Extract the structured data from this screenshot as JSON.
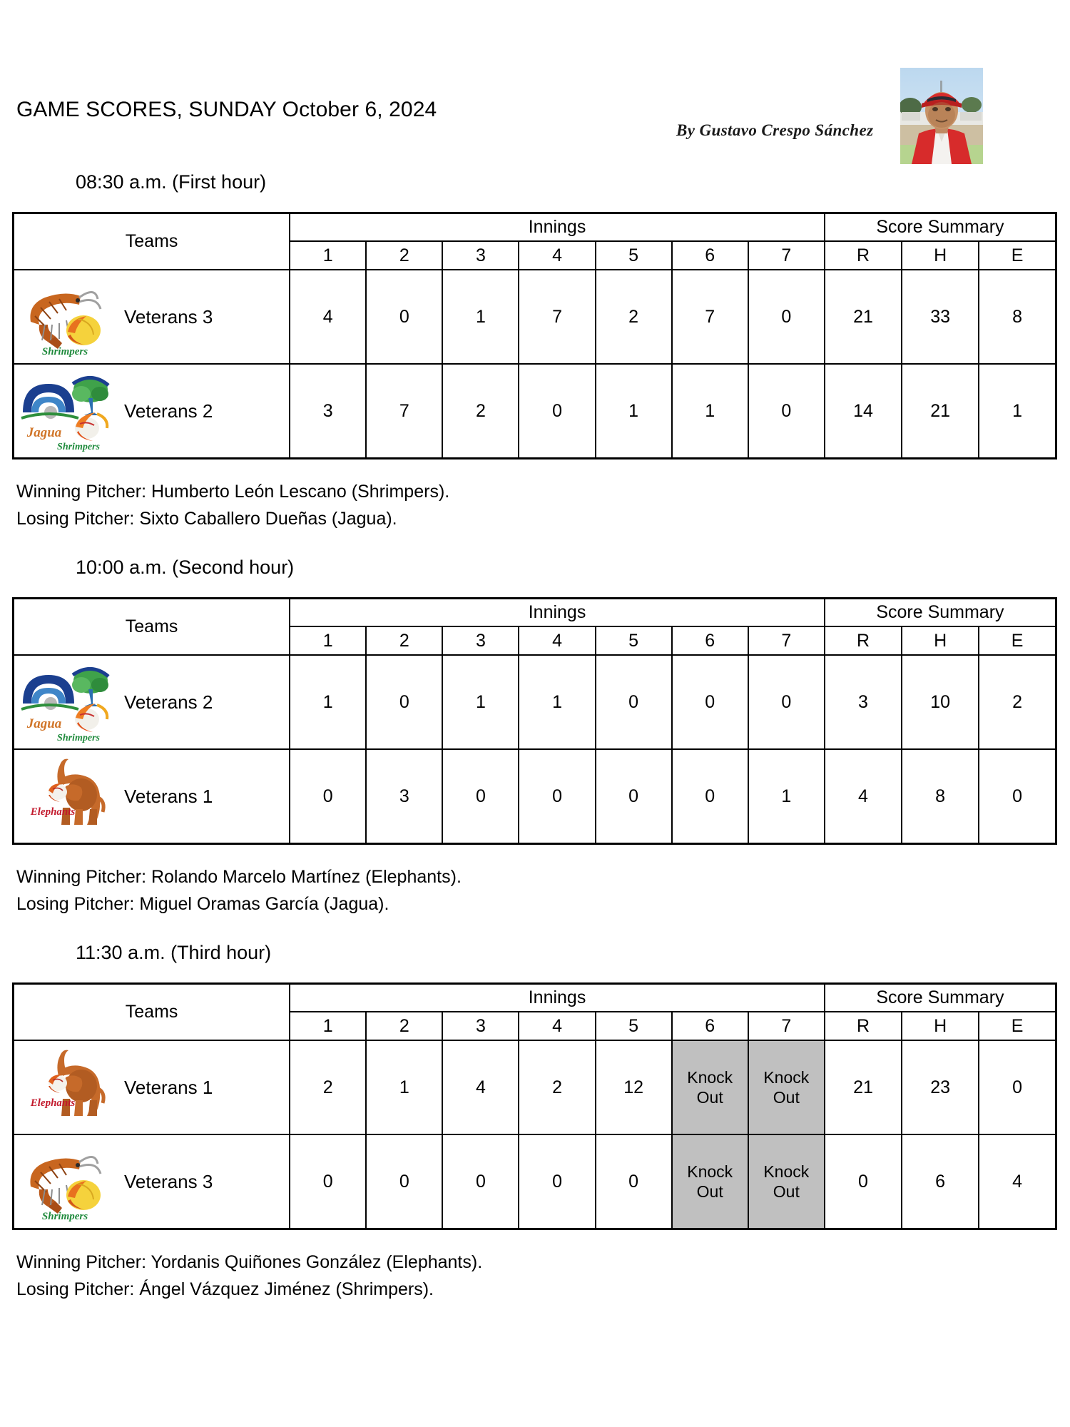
{
  "document": {
    "title": "GAME SCORES, SUNDAY October 6, 2024",
    "byline": "By Gustavo Crespo Sánchez",
    "photo_alt": "author-photo"
  },
  "table_headers": {
    "teams": "Teams",
    "innings": "Innings",
    "score_summary": "Score Summary",
    "innings_numbers": [
      "1",
      "2",
      "3",
      "4",
      "5",
      "6",
      "7"
    ],
    "summary_labels": [
      "R",
      "H",
      "E"
    ]
  },
  "colors": {
    "knockout_background": "#c0c0c0",
    "border": "#000000",
    "page_background": "#ffffff"
  },
  "games": [
    {
      "time_heading": "08:30 a.m. (First hour)",
      "innings_header_align": "left",
      "rows": [
        {
          "logo": "shrimpers-logo",
          "team": "Veterans 3",
          "innings": [
            "4",
            "0",
            "1",
            "7",
            "2",
            "7",
            "0"
          ],
          "summary": [
            "21",
            "33",
            "8"
          ]
        },
        {
          "logo": "jagua-shrimpers-logo",
          "team": "Veterans 2",
          "innings": [
            "3",
            "7",
            "2",
            "0",
            "1",
            "1",
            "0"
          ],
          "summary": [
            "14",
            "21",
            "1"
          ]
        }
      ],
      "winning_pitcher": "Winning Pitcher: Humberto León Lescano (Shrimpers).",
      "losing_pitcher": "Losing Pitcher: Sixto Caballero Dueñas (Jagua)."
    },
    {
      "time_heading": "10:00 a.m. (Second hour)",
      "innings_header_align": "center",
      "rows": [
        {
          "logo": "jagua-shrimpers-logo",
          "team": "Veterans 2",
          "innings": [
            "1",
            "0",
            "1",
            "1",
            "0",
            "0",
            "0"
          ],
          "summary": [
            "3",
            "10",
            "2"
          ]
        },
        {
          "logo": "elephants-logo",
          "team": "Veterans 1",
          "innings": [
            "0",
            "3",
            "0",
            "0",
            "0",
            "0",
            "1"
          ],
          "summary": [
            "4",
            "8",
            "0"
          ]
        }
      ],
      "winning_pitcher": "Winning Pitcher: Rolando Marcelo Martínez (Elephants).",
      "losing_pitcher": "Losing Pitcher: Miguel Oramas García (Jagua)."
    },
    {
      "time_heading": "11:30 a.m. (Third hour)",
      "innings_header_align": "center",
      "rows": [
        {
          "logo": "elephants-logo",
          "team": "Veterans 1",
          "innings": [
            "2",
            "1",
            "4",
            "2",
            "12",
            "Knock Out",
            "Knock Out"
          ],
          "summary": [
            "21",
            "23",
            "0"
          ]
        },
        {
          "logo": "shrimpers-logo",
          "team": "Veterans 3",
          "innings": [
            "0",
            "0",
            "0",
            "0",
            "0",
            "Knock Out",
            "Knock Out"
          ],
          "summary": [
            "0",
            "6",
            "4"
          ]
        }
      ],
      "winning_pitcher": "Winning Pitcher: Yordanis Quiñones González (Elephants).",
      "losing_pitcher": "Losing Pitcher: Ángel Vázquez Jiménez (Shrimpers)."
    }
  ]
}
